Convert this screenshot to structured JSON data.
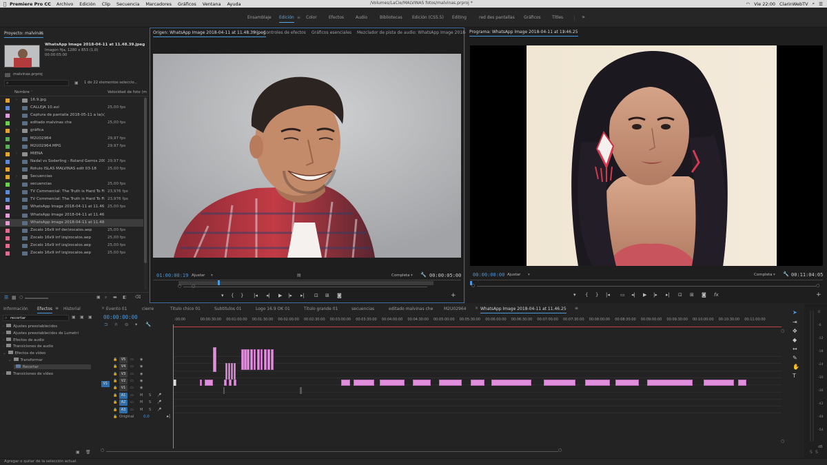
{
  "menubar": {
    "app": "Premiere Pro CC",
    "items": [
      "Archivo",
      "Edición",
      "Clip",
      "Secuencia",
      "Marcadores",
      "Gráficos",
      "Ventana",
      "Ayuda"
    ],
    "window_title": "/Volumes/LaCie/MALVINAS fotos/malvinas.prproj *",
    "clock": "Vie 22:00",
    "user": "ClarinWebTV"
  },
  "workspaces": {
    "items": [
      "Ensamblaje",
      "Edición",
      "Color",
      "Efectos",
      "Audio",
      "Bibliotecas",
      "Edición (CS5.5)",
      "Editing",
      "red des pantallas",
      "Gráficos",
      "Títles"
    ],
    "active_index": 1,
    "more": "»"
  },
  "project": {
    "title": "Proyecto: malvinas",
    "menu": "≡",
    "clip_name": "WhatsApp Image 2018-04-11 at 11.48.39.jpeg",
    "clip_info": "Imagen fija, 1280 x 853 (1,0)",
    "clip_duration": "00:00:05:00",
    "file": "malvinas.prproj",
    "search_placeholder": "",
    "selection_count": "1 de 22 elementos seleccio...",
    "col_name": "Nombre",
    "col_fps": "Velocidad de foto (m",
    "items": [
      {
        "name": "16.9.jpg",
        "fps": "",
        "color": "#e8a32b",
        "folder": true
      },
      {
        "name": "CALLEJA 10.avi",
        "fps": "25,00 fps",
        "color": "#5b8ad6",
        "folder": false
      },
      {
        "name": "Captura de pantalla 2018-05-11 a la(s) 2",
        "fps": "",
        "color": "#e59ad8",
        "folder": false
      },
      {
        "name": "editado malvinas che",
        "fps": "25,00 fps",
        "color": "#6ad14b",
        "folder": false
      },
      {
        "name": "gráfica",
        "fps": "",
        "color": "#e8a32b",
        "folder": true
      },
      {
        "name": "M2U02964",
        "fps": "29,97 fps",
        "color": "#5bb055",
        "folder": false
      },
      {
        "name": "M2U02964.MPG",
        "fps": "29,97 fps",
        "color": "#5bb055",
        "folder": false
      },
      {
        "name": "MIENA",
        "fps": "",
        "color": "#e8a32b",
        "folder": true
      },
      {
        "name": "Nadal vs Soderling - Roland Garros 2009",
        "fps": "29,97 fps",
        "color": "#5b8ad6",
        "folder": false
      },
      {
        "name": "Rótulo ISLAS MALVINAS edit 03-18",
        "fps": "25,00 fps",
        "color": "#e8a32b",
        "folder": false
      },
      {
        "name": "Secuencias",
        "fps": "",
        "color": "#e8a32b",
        "folder": true
      },
      {
        "name": "secuencias",
        "fps": "25,00 fps",
        "color": "#6ad14b",
        "folder": false
      },
      {
        "name": "TV Commercial: The Truth is Hard To Find",
        "fps": "23,976 fps",
        "color": "#5b8ad6",
        "folder": false
      },
      {
        "name": "TV Commercial: The Truth is Hard To Find",
        "fps": "23,976 fps",
        "color": "#5b8ad6",
        "folder": false
      },
      {
        "name": "WhatsApp Image 2018-04-11 at 11.46.25",
        "fps": "25,00 fps",
        "color": "#e59ad8",
        "folder": false
      },
      {
        "name": "WhatsApp Image 2018-04-11 at 11.46.25",
        "fps": "",
        "color": "#e59ad8",
        "folder": false
      },
      {
        "name": "WhatsApp Image 2018-04-11 at 11.48.39",
        "fps": "",
        "color": "#e59ad8",
        "folder": false
      },
      {
        "name": "Zocalo 16x9 inf der/zocalos.aep",
        "fps": "25,00 fps",
        "color": "#e8698e",
        "folder": false
      },
      {
        "name": "Zocalo 16x9 inf izq/zocalos.aep",
        "fps": "25,00 fps",
        "color": "#e8698e",
        "folder": false
      },
      {
        "name": "Zocalo 16x9 inf izq/zocalos.aep",
        "fps": "25,00 fps",
        "color": "#e8698e",
        "folder": false
      },
      {
        "name": "Zocalo 16x9 inf izq/zocalos.aep",
        "fps": "25,00 fps",
        "color": "#e8698e",
        "folder": false
      }
    ],
    "selected_index": 16
  },
  "source": {
    "tabs": [
      "Origen: WhatsApp Image 2018-04-11 at 11.48.39.jpeg",
      "Controles de efectos",
      "Gráficos esenciales",
      "Mezclador de pista de audio: WhatsApp Image 2018-0"
    ],
    "timecode": "01:00:00:19",
    "fit": "Ajustar",
    "quality": "Completa",
    "duration": "00:00:05:00"
  },
  "program": {
    "tab": "Programa: WhatsApp Image 2018-04-11 at 11.46.25",
    "timecode": "00:00:00:00",
    "fit": "Ajustar",
    "quality": "Completa",
    "duration": "00:11:04:05"
  },
  "effects": {
    "tabs": [
      "Información",
      "Efectos",
      "Historial"
    ],
    "active_tab": 1,
    "search": "recortar",
    "items": [
      {
        "label": "Ajustes preestablecidos",
        "indent": 0
      },
      {
        "label": "Ajustes preestablecidos de Lumetri",
        "indent": 0
      },
      {
        "label": "Efectos de audio",
        "indent": 0
      },
      {
        "label": "Transiciones de audio",
        "indent": 0
      },
      {
        "label": "Efectos de vídeo",
        "indent": 0
      },
      {
        "label": "Transformar",
        "indent": 1
      },
      {
        "label": "Recortar",
        "indent": 2
      },
      {
        "label": "Transiciones de vídeo",
        "indent": 0
      }
    ]
  },
  "timeline": {
    "tabs": [
      "Evento 01",
      "cierre",
      "Titulo chico 01",
      "Subtitulos 01",
      "Logo 16.9 OK 01",
      "Titulo grande 01",
      "secuencias",
      "editado malvinas che",
      "M2U02964",
      "WhatsApp Image 2018-04-11 at 11.46.25"
    ],
    "active_tab": 9,
    "timecode": "00:00:00:00",
    "ruler": [
      ":00:00",
      "00:00:30:00",
      "00:01:00:00",
      "00:01:30:00",
      "00:02:00:00",
      "00:02:30:00",
      "00:03:00:00",
      "00:03:30:00",
      "00:04:00:00",
      "00:04:30:00",
      "00:05:00:00",
      "00:05:30:00",
      "00:06:00:00",
      "00:06:30:00",
      "00:07:00:00",
      "00:07:30:00",
      "00:08:00:00",
      "00:08:30:00",
      "00:09:00:00",
      "00:09:30:00",
      "00:10:00:00",
      "00:10:30:00",
      "00:11:00:00"
    ],
    "video_tracks": [
      "V5",
      "V4",
      "V3",
      "V2",
      "V1"
    ],
    "audio_tracks": [
      "A1",
      "A2",
      "A3"
    ],
    "source_patch_v": "V1",
    "master": "Original",
    "master_value": "0,0"
  },
  "meters": {
    "scale": [
      "0",
      "-6",
      "-12",
      "-18",
      "-24",
      "-30",
      "-36",
      "-42",
      "-48",
      "-54"
    ],
    "unit": "dB"
  },
  "status": "Agregar o quitar de la selección actual.",
  "colors": {
    "accent": "#4b9be0",
    "clip": "#e08fdc"
  }
}
